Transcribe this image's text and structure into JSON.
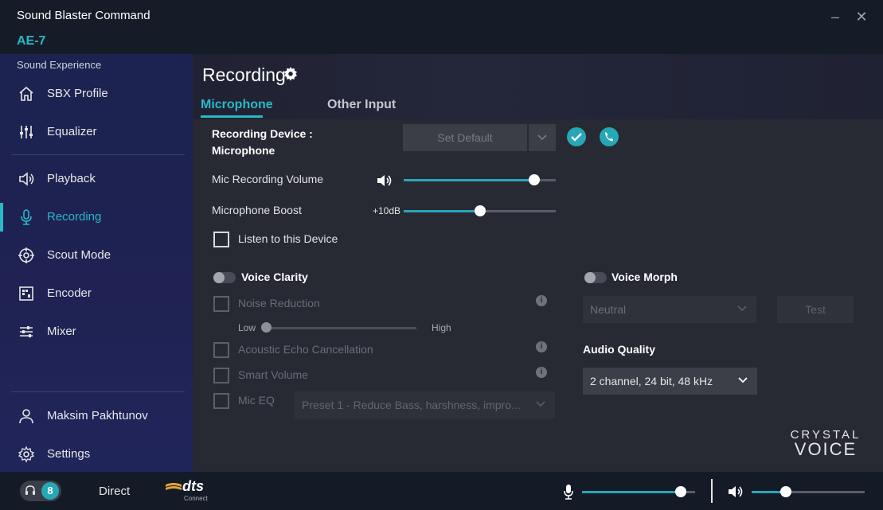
{
  "app": {
    "title": "Sound Blaster Command",
    "device": "AE-7",
    "window_controls": {
      "minimize": "–",
      "close": "✕"
    }
  },
  "sidebar": {
    "section_label": "Sound Experience",
    "items": [
      {
        "label": "SBX Profile",
        "icon": "home-icon"
      },
      {
        "label": "Equalizer",
        "icon": "equalizer-icon"
      },
      {
        "label": "Playback",
        "icon": "speaker-icon"
      },
      {
        "label": "Recording",
        "icon": "microphone-icon",
        "active": true
      },
      {
        "label": "Scout Mode",
        "icon": "crosshair-icon"
      },
      {
        "label": "Encoder",
        "icon": "encoder-icon"
      },
      {
        "label": "Mixer",
        "icon": "mixer-icon"
      }
    ],
    "bottom_items": [
      {
        "label": "Maksim Pakhtunov",
        "icon": "user-icon"
      },
      {
        "label": "Settings",
        "icon": "gear-icon"
      }
    ]
  },
  "main": {
    "title": "Recording",
    "tabs": [
      {
        "label": "Microphone",
        "active": true
      },
      {
        "label": "Other Input",
        "active": false
      }
    ],
    "recording_device": {
      "label_line1": "Recording Device :",
      "label_line2": "Microphone",
      "set_default_label": "Set Default"
    },
    "mic_volume": {
      "label": "Mic Recording Volume",
      "value": 0.86
    },
    "mic_boost": {
      "label": "Microphone Boost",
      "value_text": "+10dB",
      "value": 0.5
    },
    "listen": {
      "label": "Listen to this Device",
      "checked": false
    },
    "voice_clarity": {
      "label": "Voice Clarity",
      "enabled": false,
      "noise_reduction": {
        "label": "Noise Reduction",
        "low": "Low",
        "high": "High",
        "value": 0.0
      },
      "echo_cancellation": {
        "label": "Acoustic Echo Cancellation"
      },
      "smart_volume": {
        "label": "Smart Volume"
      },
      "mic_eq": {
        "label": "Mic EQ",
        "preset": "Preset 1 - Reduce Bass, harshness, impro..."
      }
    },
    "voice_morph": {
      "label": "Voice Morph",
      "enabled": false,
      "preset": "Neutral",
      "test_label": "Test"
    },
    "audio_quality": {
      "label": "Audio Quality",
      "value": "2 channel, 24 bit, 48 kHz"
    },
    "brand": {
      "line1": "CRYSTAL",
      "line2": "VOICE"
    }
  },
  "bottom_bar": {
    "headphone_badge": "8",
    "mode_label": "Direct",
    "dts_logo": "dts",
    "dts_sub": "Connect",
    "mic_level": 0.87,
    "speaker_level": 0.3
  },
  "colors": {
    "accent": "#26a7b6",
    "accent_text": "#2ab8c6",
    "sidebar_bg": "#1f2252",
    "content_bg": "#272933"
  }
}
